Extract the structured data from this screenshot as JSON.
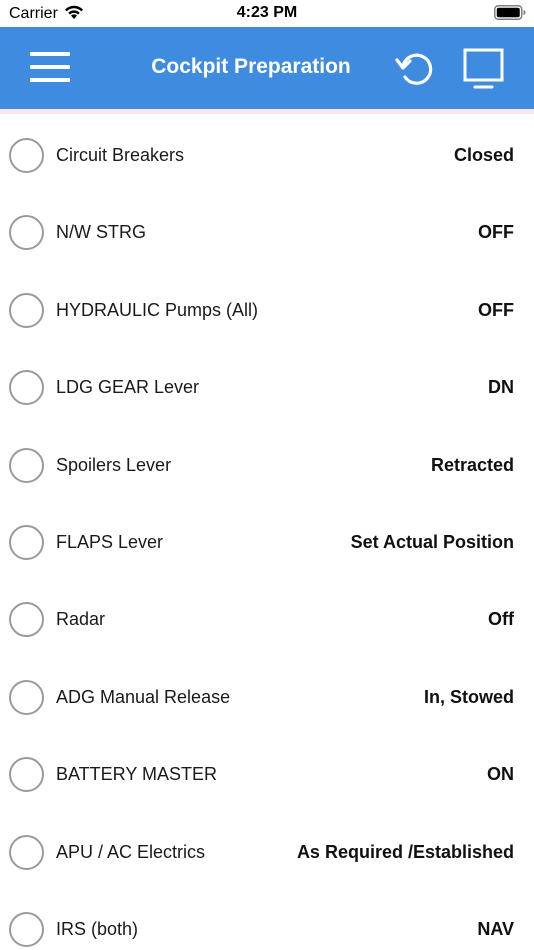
{
  "status_bar": {
    "carrier": "Carrier",
    "time": "4:23 PM"
  },
  "nav": {
    "title": "Cockpit Preparation",
    "icons": [
      "menu-icon",
      "reset-icon",
      "display-icon"
    ],
    "background_color": "#3e8be0"
  },
  "checklist": {
    "items": [
      {
        "label": "Circuit Breakers",
        "value": "Closed",
        "checked": false
      },
      {
        "label": "N/W STRG",
        "value": "OFF",
        "checked": false
      },
      {
        "label": "HYDRAULIC Pumps (All)",
        "value": "OFF",
        "checked": false
      },
      {
        "label": "LDG GEAR Lever",
        "value": "DN",
        "checked": false
      },
      {
        "label": "Spoilers Lever",
        "value": "Retracted",
        "checked": false
      },
      {
        "label": "FLAPS Lever",
        "value": "Set Actual Position",
        "checked": false
      },
      {
        "label": "Radar",
        "value": "Off",
        "checked": false
      },
      {
        "label": "ADG Manual Release",
        "value": "In, Stowed",
        "checked": false
      },
      {
        "label": "BATTERY MASTER",
        "value": "ON",
        "checked": false
      },
      {
        "label": "APU / AC Electrics",
        "value": "As Required /Established",
        "checked": false
      },
      {
        "label": "IRS (both)",
        "value": "NAV",
        "checked": false
      }
    ]
  }
}
